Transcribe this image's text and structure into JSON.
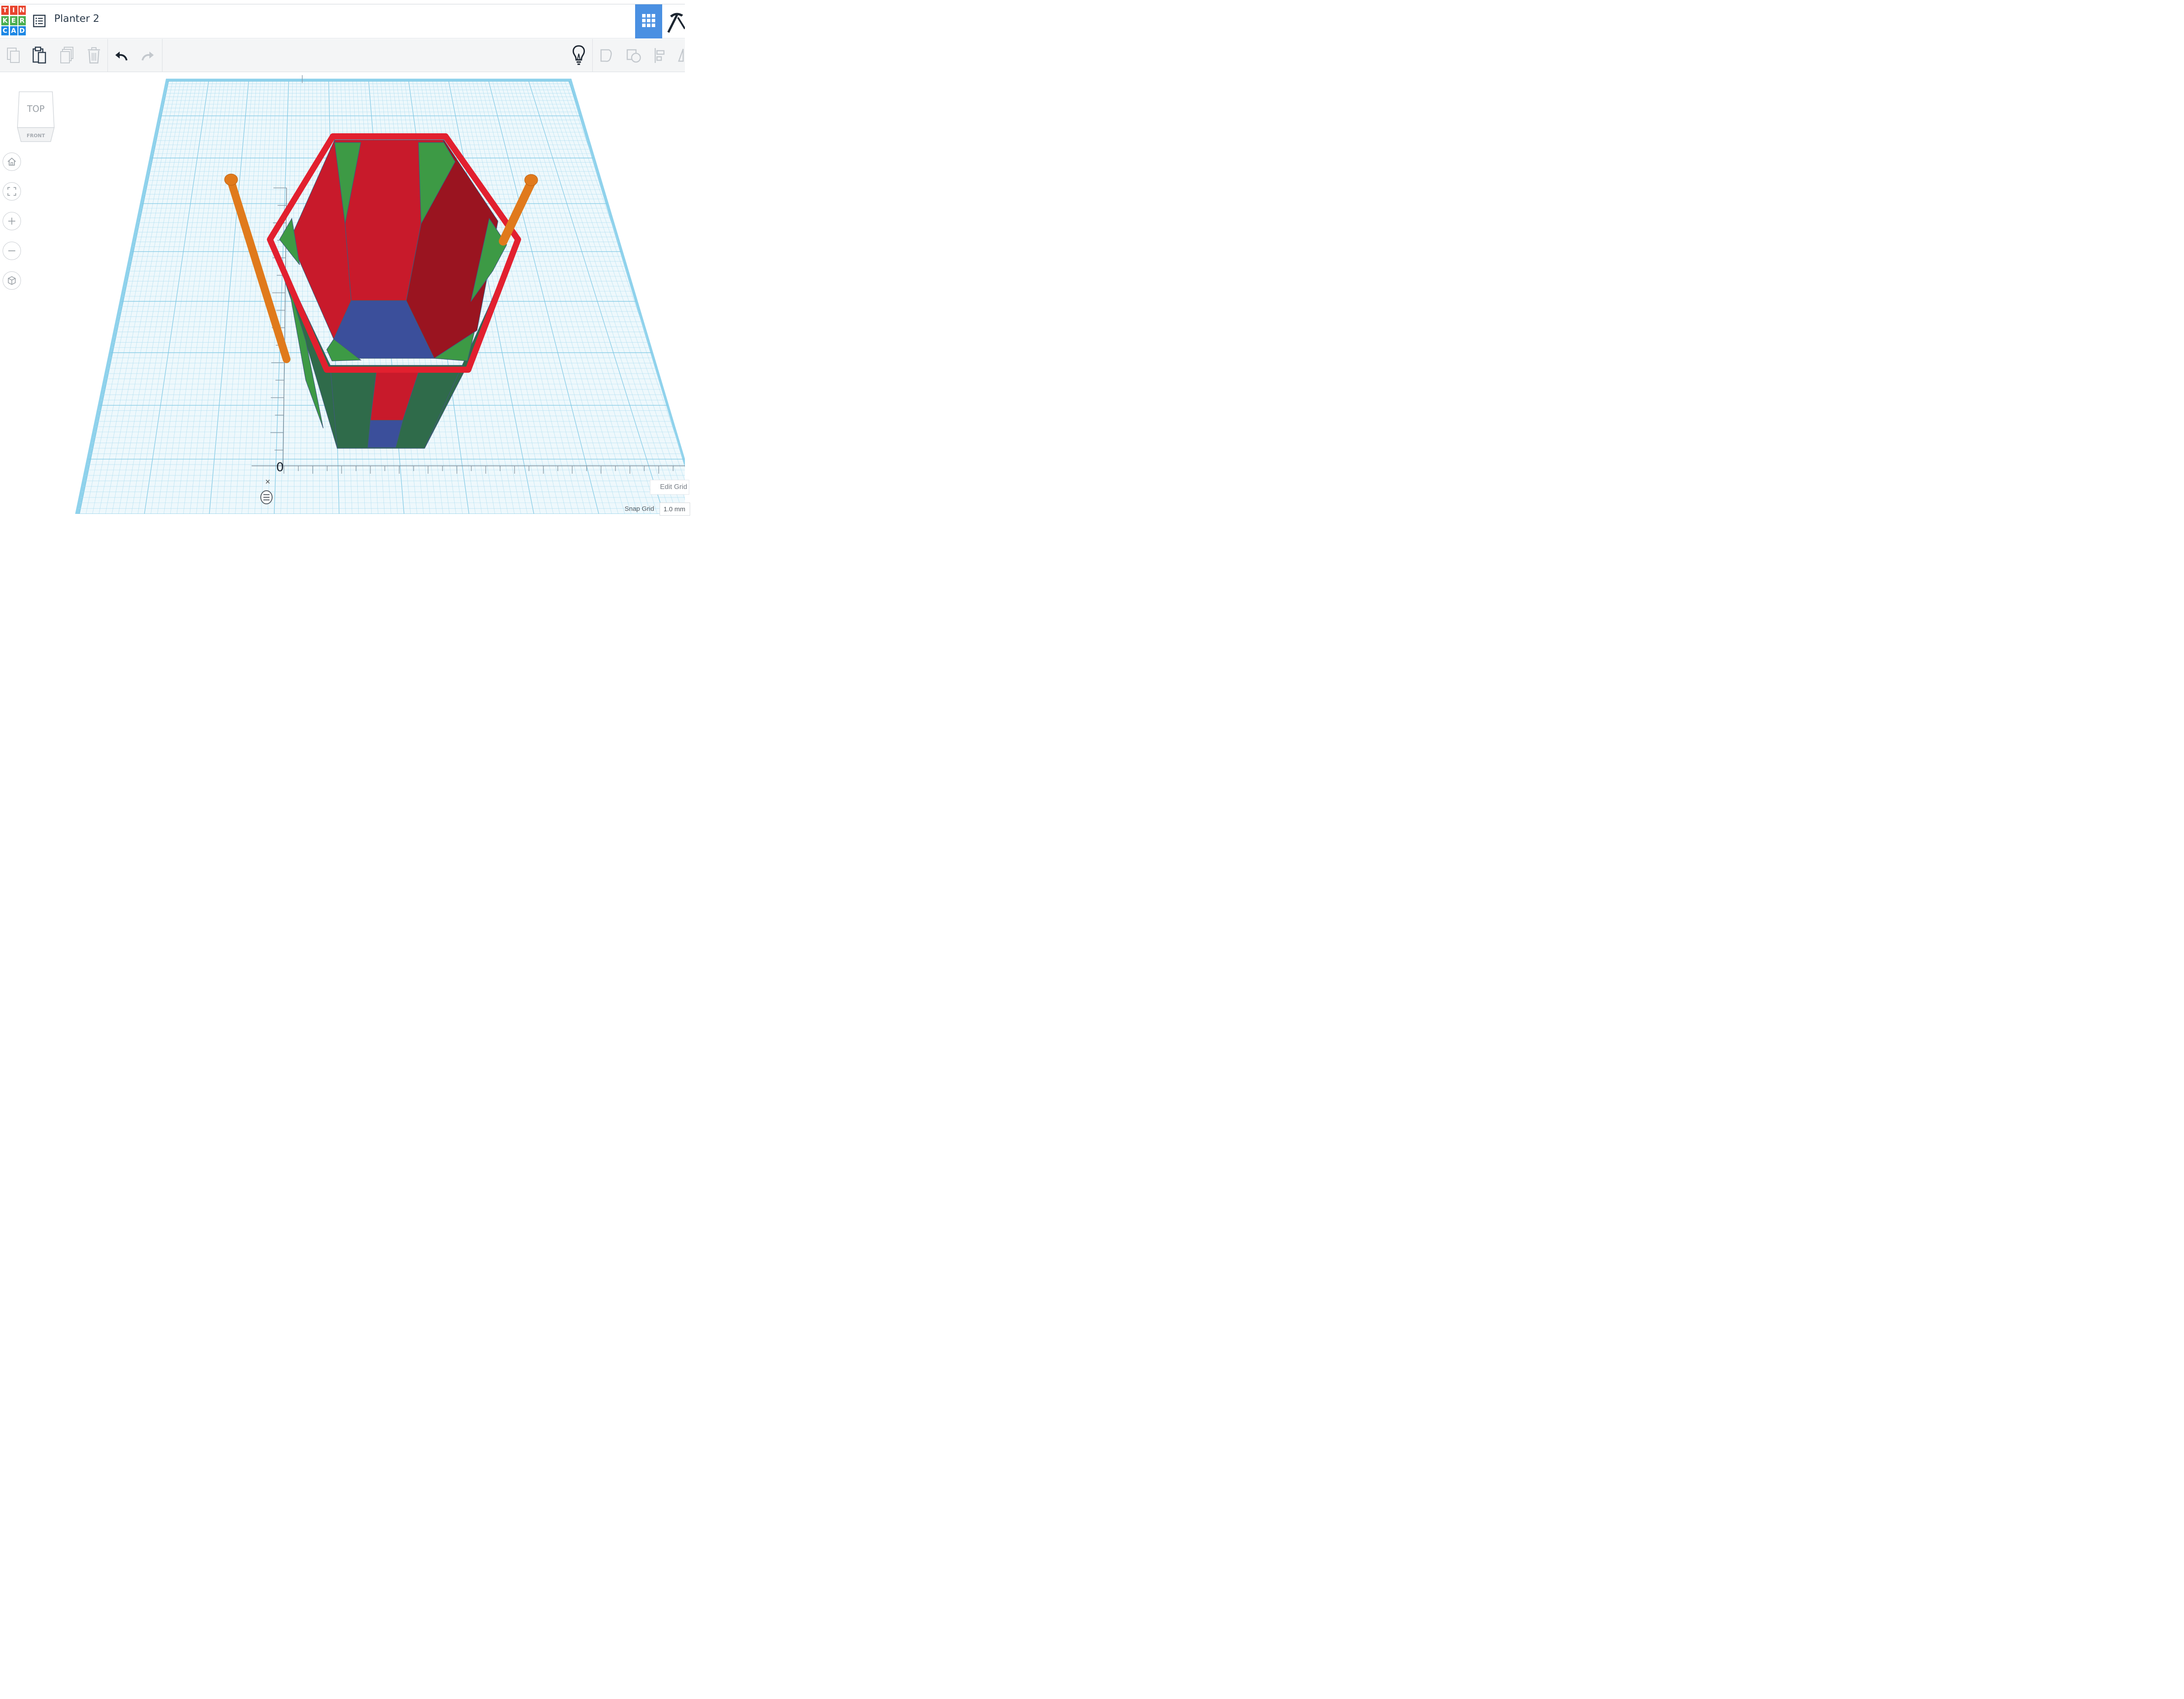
{
  "app": {
    "logo_letters": [
      "T",
      "I",
      "N",
      "K",
      "E",
      "R",
      "C",
      "A",
      "D"
    ],
    "logo_colors": [
      "#e8442e",
      "#e8442e",
      "#e8442e",
      "#4caf50",
      "#4caf50",
      "#4caf50",
      "#1e88e5",
      "#1e88e5",
      "#1e88e5"
    ],
    "project_title": "Planter 2"
  },
  "header": {
    "menu_icon": "list-icon",
    "view_icon": "grid-icon",
    "pickaxe_icon": "pickaxe-icon",
    "accent_color": "#4a90e2"
  },
  "toolbar": {
    "items": [
      {
        "name": "copy-button",
        "icon": "copy-icon",
        "enabled": false
      },
      {
        "name": "paste-button",
        "icon": "paste-icon",
        "enabled": true
      },
      {
        "name": "duplicate-button",
        "icon": "duplicate-icon",
        "enabled": false
      },
      {
        "name": "delete-button",
        "icon": "trash-icon",
        "enabled": false
      },
      {
        "name": "undo-button",
        "icon": "undo-icon",
        "enabled": true
      },
      {
        "name": "redo-button",
        "icon": "redo-icon",
        "enabled": false
      },
      {
        "name": "notes-button",
        "icon": "lightbulb-icon",
        "enabled": true
      },
      {
        "name": "group-button",
        "icon": "group-icon",
        "enabled": false
      },
      {
        "name": "ungroup-button",
        "icon": "ungroup-icon",
        "enabled": false
      },
      {
        "name": "align-button",
        "icon": "align-icon",
        "enabled": false
      },
      {
        "name": "mirror-button",
        "icon": "mirror-icon",
        "enabled": false
      }
    ]
  },
  "viewcube": {
    "top_label": "TOP",
    "front_label": "FRONT"
  },
  "nav": [
    {
      "name": "home-view-button",
      "icon": "home-icon"
    },
    {
      "name": "fit-view-button",
      "icon": "fit-icon"
    },
    {
      "name": "zoom-in-button",
      "icon": "plus-icon"
    },
    {
      "name": "zoom-out-button",
      "icon": "minus-icon"
    },
    {
      "name": "perspective-button",
      "icon": "cube-icon"
    }
  ],
  "workplane": {
    "origin_label": "0",
    "grid_color": "#a9dcef",
    "grid_major_color": "#7fc8e4",
    "edge_color": "#8fd2ec",
    "colors": {
      "rim": "#e2202f",
      "inner_wall": "#c81a2b",
      "inner_wall_dark": "#9a1420",
      "outer_green": "#3d9a45",
      "outer_green_dark": "#2f6b4a",
      "bottom": "#3b4f9b",
      "rod": "#e07a1c"
    }
  },
  "footer": {
    "close_label": "×",
    "edit_grid_label": "Edit Grid",
    "snap_grid_label": "Snap Grid",
    "snap_grid_value": "1.0 mm"
  }
}
